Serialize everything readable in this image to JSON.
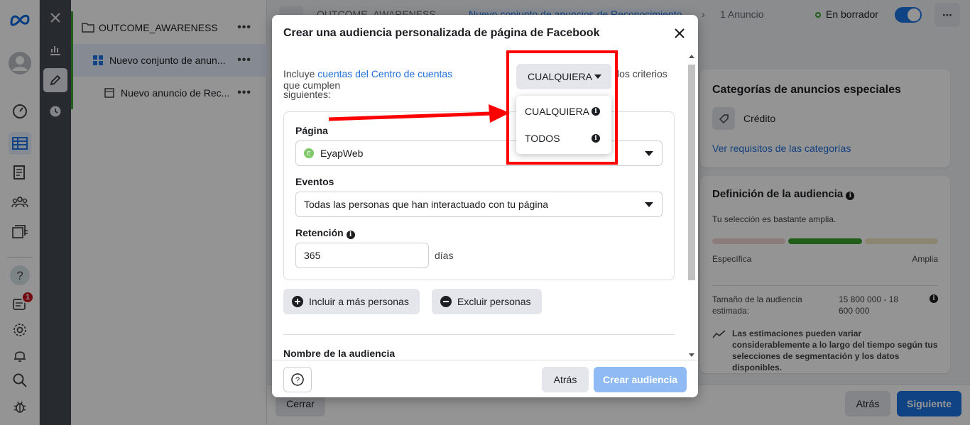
{
  "rail": {
    "badge_count": "1"
  },
  "tree": {
    "campaign": "OUTCOME_AWARENESS",
    "adset": "Nuevo conjunto de anun...",
    "ad": "Nuevo anuncio de Rec...",
    "more": "•••"
  },
  "topbar": {
    "crumb_campaign": "OUTCOME_AWARENESS",
    "crumb_adset": "Nuevo conjunto de anuncios de Reconocimiento",
    "crumb_ad": "1 Anuncio",
    "status": "En borrador"
  },
  "right": {
    "special_title": "Categorías de anuncios especiales",
    "special_item": "Crédito",
    "special_link": "Ver requisitos de las categorías",
    "aud_title": "Definición de la audiencia",
    "aud_sub": "Tu selección es bastante amplia.",
    "specific": "Específica",
    "broad": "Amplia",
    "size_label": "Tamaño de la audiencia estimada:",
    "size_value": "15 800 000 - 18 600 000",
    "estimate_note": "Las estimaciones pueden variar considerablemente a lo largo del tiempo según tus selecciones de segmentación y los datos disponibles.",
    "gauge_fill": 0.5
  },
  "bottom": {
    "close": "Cerrar",
    "back": "Atrás",
    "next": "Siguiente"
  },
  "modal": {
    "title": "Crear una audiencia personalizada de página de Facebook",
    "intro_before": "Incluye ",
    "intro_link": "cuentas del Centro de cuentas",
    "intro_after": " que cumplen",
    "intro_tail": "los criterios",
    "intro_line2": "siguientes:",
    "match_value": "CUALQUIERA",
    "page_label": "Página",
    "page_value": "EyapWeb",
    "page_initial": "E",
    "events_label": "Eventos",
    "events_value": "Todas las personas que han interactuado con tu página",
    "retention_label": "Retención",
    "retention_value": "365",
    "retention_unit": "días",
    "include_more": "Incluir a más personas",
    "exclude": "Excluir personas",
    "name_label": "Nombre de la audiencia",
    "back": "Atrás",
    "create": "Crear audiencia"
  },
  "dropdown": {
    "options": [
      "CUALQUIERA",
      "TODOS"
    ]
  },
  "colors": {
    "accent": "#1b74e4",
    "link": "#216fdb",
    "highlight": "#ff0000",
    "gauge_green": "#37a32b"
  }
}
